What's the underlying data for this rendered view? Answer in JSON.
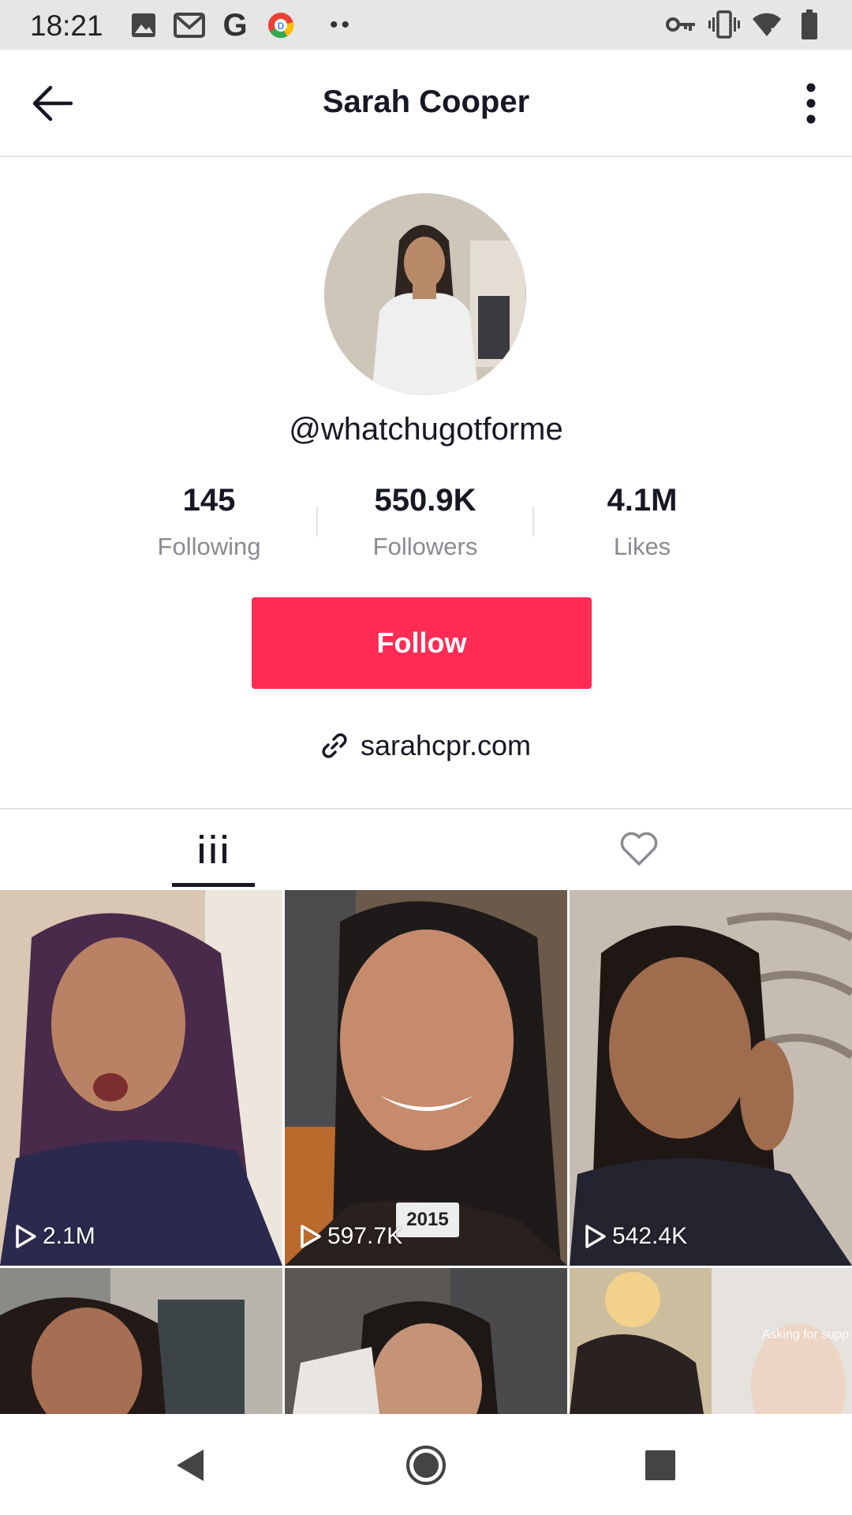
{
  "status_bar": {
    "time": "18:21",
    "left_icons": [
      "image-icon",
      "gmail-icon",
      "google-icon",
      "chrome-icon",
      "more-notifications-icon"
    ],
    "right_icons": [
      "vpn-key-icon",
      "vibrate-icon",
      "wifi-icon",
      "battery-icon"
    ]
  },
  "header": {
    "title": "Sarah Cooper"
  },
  "profile": {
    "username": "@whatchugotforme",
    "stats": [
      {
        "value": "145",
        "label": "Following"
      },
      {
        "value": "550.9K",
        "label": "Followers"
      },
      {
        "value": "4.1M",
        "label": "Likes"
      }
    ],
    "follow_label": "Follow",
    "website": "sarahcpr.com"
  },
  "tabs": {
    "videos_icon": "grid-icon",
    "liked_icon": "heart-icon"
  },
  "videos": [
    {
      "views": "2.1M"
    },
    {
      "views": "597.7K",
      "tag": "2015"
    },
    {
      "views": "542.4K"
    },
    {
      "views": ""
    },
    {
      "views": ""
    },
    {
      "views": "",
      "caption": "Asking for supp"
    }
  ],
  "colors": {
    "accent": "#fe2c55",
    "text_primary": "#161823",
    "text_secondary": "#8a8b91"
  }
}
